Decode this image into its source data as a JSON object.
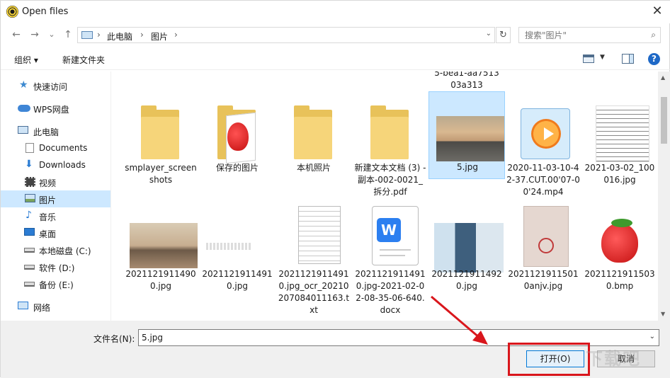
{
  "window": {
    "title": "Open files",
    "close_glyph": "✕"
  },
  "nav": {
    "back_glyph": "←",
    "forward_glyph": "→",
    "history_glyph": "⌄",
    "up_glyph": "↑",
    "breadcrumb": [
      "此电脑",
      "图片"
    ],
    "breadcrumb_sep": "›",
    "refresh_glyph": "↻",
    "search_placeholder": "搜索\"图片\"",
    "search_icon_glyph": "⌕"
  },
  "toolbar": {
    "organize": "组织 ▾",
    "new_folder": "新建文件夹",
    "view_dd": "▼",
    "help": "?"
  },
  "sidebar": {
    "items": [
      {
        "label": "快速访问",
        "icon": "star-icon"
      },
      {
        "label": "WPS网盘",
        "icon": "cloud-icon"
      },
      {
        "label": "此电脑",
        "icon": "computer-icon"
      },
      {
        "label": "Documents",
        "icon": "document-icon"
      },
      {
        "label": "Downloads",
        "icon": "download-icon"
      },
      {
        "label": "视频",
        "icon": "video-icon"
      },
      {
        "label": "图片",
        "icon": "pictures-icon",
        "selected": true
      },
      {
        "label": "音乐",
        "icon": "music-icon"
      },
      {
        "label": "桌面",
        "icon": "desktop-icon"
      },
      {
        "label": "本地磁盘 (C:)",
        "icon": "drive-icon"
      },
      {
        "label": "软件 (D:)",
        "icon": "drive-icon"
      },
      {
        "label": "备份 (E:)",
        "icon": "drive-icon"
      },
      {
        "label": "网络",
        "icon": "network-icon"
      }
    ]
  },
  "files": {
    "partial_top": "5-bea1-aa7513\n03a313",
    "row1": [
      {
        "name": "smplayer_screenshots",
        "kind": "folder"
      },
      {
        "name": "保存的图片",
        "kind": "folder-image"
      },
      {
        "name": "本机照片",
        "kind": "folder"
      },
      {
        "name": "新建文本文档 (3) - 副本-002-0021_拆分.pdf",
        "kind": "folder"
      },
      {
        "name": "5.jpg",
        "kind": "image",
        "selected": true
      },
      {
        "name": "2020-11-03-10-42-37.CUT.00'07-00'24.mp4",
        "kind": "video"
      },
      {
        "name": "2021-03-02_100016.jpg",
        "kind": "image-text"
      }
    ],
    "row2": [
      {
        "name": "20211219114900.jpg",
        "kind": "image"
      },
      {
        "name": "20211219114910.jpg",
        "kind": "image"
      },
      {
        "name": "20211219114910.jpg_ocr_20210207084011163.txt",
        "kind": "text"
      },
      {
        "name": "20211219114910.jpg-2021-02-02-08-35-06-640.docx",
        "kind": "word"
      },
      {
        "name": "20211219114920.jpg",
        "kind": "image"
      },
      {
        "name": "20211219115010anjv.jpg",
        "kind": "image"
      },
      {
        "name": "20211219115030.bmp",
        "kind": "image"
      }
    ]
  },
  "bottom": {
    "filename_label": "文件名(N):",
    "filename_value": "5.jpg",
    "filename_dd": "⌄",
    "open_label": "打开(O)",
    "cancel_label": "取消"
  },
  "scroll": {
    "up": "▲",
    "down": "▼"
  },
  "watermark": "下载吧",
  "colors": {
    "accent": "#0078d7",
    "highlight": "#d9161c",
    "selection": "#cce8ff"
  }
}
